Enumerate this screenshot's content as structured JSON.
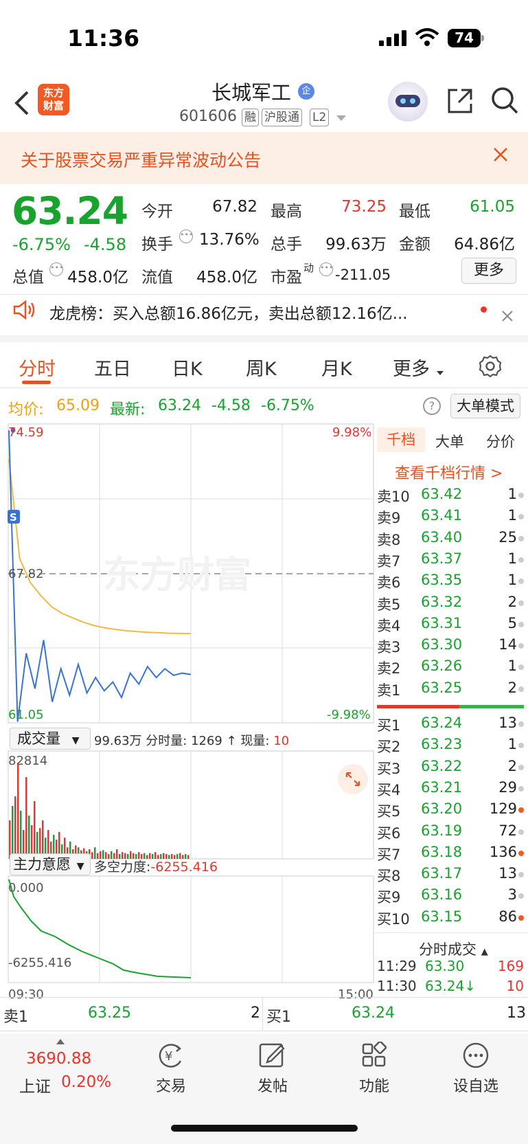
{
  "status_bar": {
    "time": "11:36",
    "battery": "74"
  },
  "header": {
    "logo_line1": "东方",
    "logo_line2": "财富",
    "stock_name": "长城军工",
    "qi_badge": "企",
    "stock_code": "601606",
    "tags": [
      "融",
      "沪股通",
      "L2"
    ]
  },
  "notice": {
    "text": "关于股票交易严重异常波动公告"
  },
  "quote": {
    "price": "63.24",
    "change_pct": "-6.75%",
    "change_amt": "-4.58",
    "open_label": "今开",
    "open": "67.82",
    "high_label": "最高",
    "high": "73.25",
    "low_label": "最低",
    "low": "61.05",
    "turnover_label": "换手",
    "turnover": "13.76%",
    "volume_label": "总手",
    "volume": "99.63万",
    "amount_label": "金额",
    "amount": "64.86亿",
    "mktcap_label": "总值",
    "mktcap": "458.0亿",
    "float_label": "流值",
    "float_cap": "458.0亿",
    "pe_label": "市盈",
    "pe_sup": "动",
    "pe": "-211.05",
    "more": "更多"
  },
  "dragon": {
    "text": "龙虎榜：买入总额16.86亿元，卖出总额12.16亿..."
  },
  "tabs": [
    "分时",
    "五日",
    "日K",
    "周K",
    "月K",
    "更多"
  ],
  "info_line": {
    "avg_label": "均价:",
    "avg": "65.09",
    "latest_label": "最新:",
    "latest": "63.24",
    "chg": "-4.58",
    "pct": "-6.75%",
    "help": "?",
    "mode_button": "大单模式"
  },
  "watermark": "东方财富",
  "chart_labels": {
    "top_left": "74.59",
    "top_right": "9.98%",
    "mid_left": "67.82",
    "bottom_left": "61.05",
    "bottom_right": "-9.98%",
    "s_marker": "S",
    "vol_selector": "成交量",
    "vol_info_total": "99.63万",
    "vol_info_min_label": "分时量:",
    "vol_info_min": "1269",
    "vol_info_now_label": "现量:",
    "vol_info_now": "10",
    "vol_max": "82814",
    "main_selector": "主力意愿",
    "main_info_label": "多空力度:",
    "main_info_val": "-6255.416",
    "main_top": "0.000",
    "main_bottom": "-6255.416",
    "time_start": "09:30",
    "time_end": "15:00"
  },
  "chart_data": {
    "type": "line",
    "x_range": [
      "09:30",
      "15:00"
    ],
    "ylim": [
      61.05,
      74.59
    ],
    "pct_range": [
      "9.98%",
      "-9.98%"
    ],
    "prev_close": 67.82,
    "series": [
      {
        "name": "均价",
        "color": "#f5b942",
        "values": [
          73.0,
          68.5,
          67.4,
          66.8,
          66.3,
          66.0,
          65.8,
          65.6,
          65.45,
          65.35,
          65.28,
          65.22,
          65.18,
          65.15,
          65.13,
          65.11,
          65.1,
          65.09
        ]
      },
      {
        "name": "最新",
        "color": "#3673d2",
        "values": [
          74.3,
          61.1,
          64.2,
          62.6,
          64.8,
          62.0,
          63.5,
          62.3,
          63.7,
          62.4,
          63.1,
          62.5,
          62.9,
          62.2,
          63.3,
          62.8,
          63.6,
          63.1,
          63.5,
          63.2,
          63.3,
          63.24
        ]
      }
    ]
  },
  "order_book": {
    "tabs": [
      "千档",
      "大单",
      "分价"
    ],
    "link": "查看千档行情 >",
    "asks": [
      {
        "label": "卖10",
        "price": "63.42",
        "qty": "1",
        "dot": "gray"
      },
      {
        "label": "卖9",
        "price": "63.41",
        "qty": "1",
        "dot": "gray"
      },
      {
        "label": "卖8",
        "price": "63.40",
        "qty": "25",
        "dot": "gray"
      },
      {
        "label": "卖7",
        "price": "63.37",
        "qty": "1",
        "dot": "gray"
      },
      {
        "label": "卖6",
        "price": "63.35",
        "qty": "1",
        "dot": "gray"
      },
      {
        "label": "卖5",
        "price": "63.32",
        "qty": "2",
        "dot": "gray"
      },
      {
        "label": "卖4",
        "price": "63.31",
        "qty": "5",
        "dot": "gray"
      },
      {
        "label": "卖3",
        "price": "63.30",
        "qty": "14",
        "dot": "gray"
      },
      {
        "label": "卖2",
        "price": "63.26",
        "qty": "1",
        "dot": "gray"
      },
      {
        "label": "卖1",
        "price": "63.25",
        "qty": "2",
        "dot": "gray"
      }
    ],
    "bids": [
      {
        "label": "买1",
        "price": "63.24",
        "qty": "13",
        "dot": "gray"
      },
      {
        "label": "买2",
        "price": "63.23",
        "qty": "1",
        "dot": "gray"
      },
      {
        "label": "买3",
        "price": "63.22",
        "qty": "2",
        "dot": "gray"
      },
      {
        "label": "买4",
        "price": "63.21",
        "qty": "29",
        "dot": "gray"
      },
      {
        "label": "买5",
        "price": "63.20",
        "qty": "129",
        "dot": "orange"
      },
      {
        "label": "买6",
        "price": "63.19",
        "qty": "72",
        "dot": "gray"
      },
      {
        "label": "买7",
        "price": "63.18",
        "qty": "136",
        "dot": "orange"
      },
      {
        "label": "买8",
        "price": "63.17",
        "qty": "13",
        "dot": "gray"
      },
      {
        "label": "买9",
        "price": "63.16",
        "qty": "3",
        "dot": "gray"
      },
      {
        "label": "买10",
        "price": "63.15",
        "qty": "86",
        "dot": "orange"
      }
    ],
    "trades_title": "分时成交",
    "trades": [
      {
        "time": "11:29",
        "price": "63.30",
        "qty": "169",
        "price_color": "#17a32e",
        "qty_color": "#e8352c"
      },
      {
        "time": "11:30",
        "price": "63.24↓",
        "qty": "10",
        "price_color": "#17a32e",
        "qty_color": "#e8352c"
      }
    ]
  },
  "bottom_strip": {
    "sell_label": "卖1",
    "sell_price": "63.25",
    "sell_qty": "2",
    "buy_label": "买1",
    "buy_price": "63.24",
    "buy_qty": "13"
  },
  "bottom_bar": {
    "index_value": "3690.88",
    "index_name": "上证",
    "index_pct": "0.20%",
    "items": [
      "交易",
      "发帖",
      "功能",
      "设自选"
    ]
  }
}
